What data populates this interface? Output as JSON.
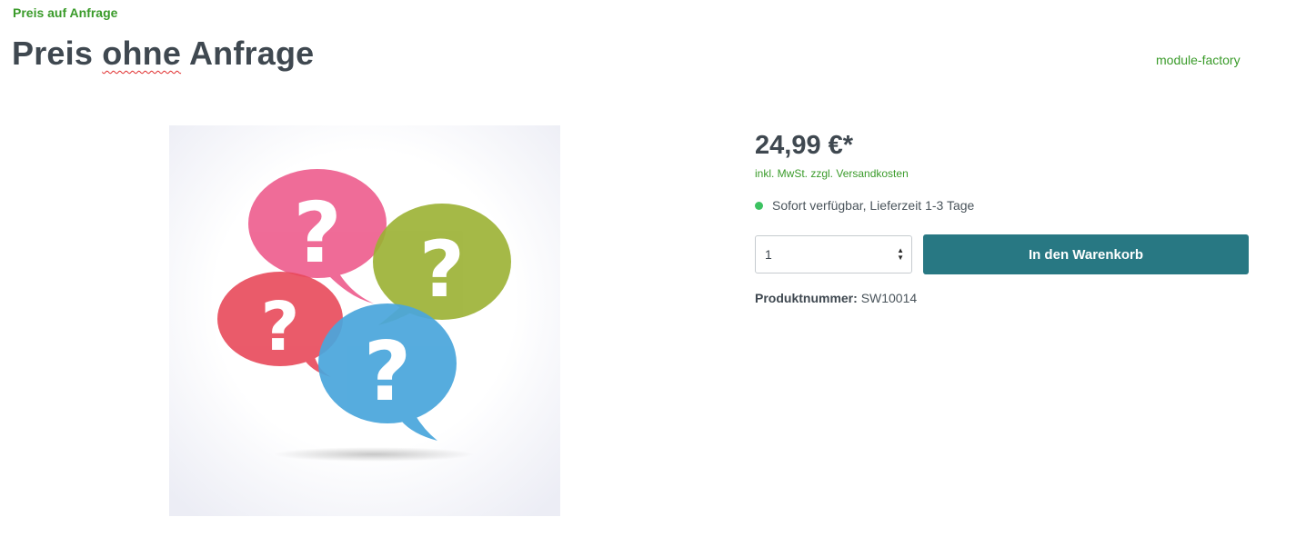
{
  "breadcrumb": "Preis auf Anfrage",
  "product": {
    "title_start": "Preis ",
    "title_misspelled": "ohne",
    "title_end": " Anfrage",
    "manufacturer": "module-factory",
    "image_icon": "speech-bubbles-question-marks",
    "price": "24,99 €*",
    "tax_note": "inkl. MwSt. zzgl. Versandkosten",
    "availability": "Sofort verfügbar, Lieferzeit 1-3 Tage",
    "quantity": "1",
    "add_to_cart_label": "In den Warenkorb",
    "product_number_label": "Produktnummer:",
    "product_number": "SW10014"
  },
  "colors": {
    "accent_green": "#3a9b2a",
    "button": "#287883",
    "available_dot": "#3cc261",
    "bubble_pink": "#ee5f8f",
    "bubble_green": "#9bb133",
    "bubble_red": "#e8495a",
    "bubble_blue": "#4aa6dc"
  }
}
